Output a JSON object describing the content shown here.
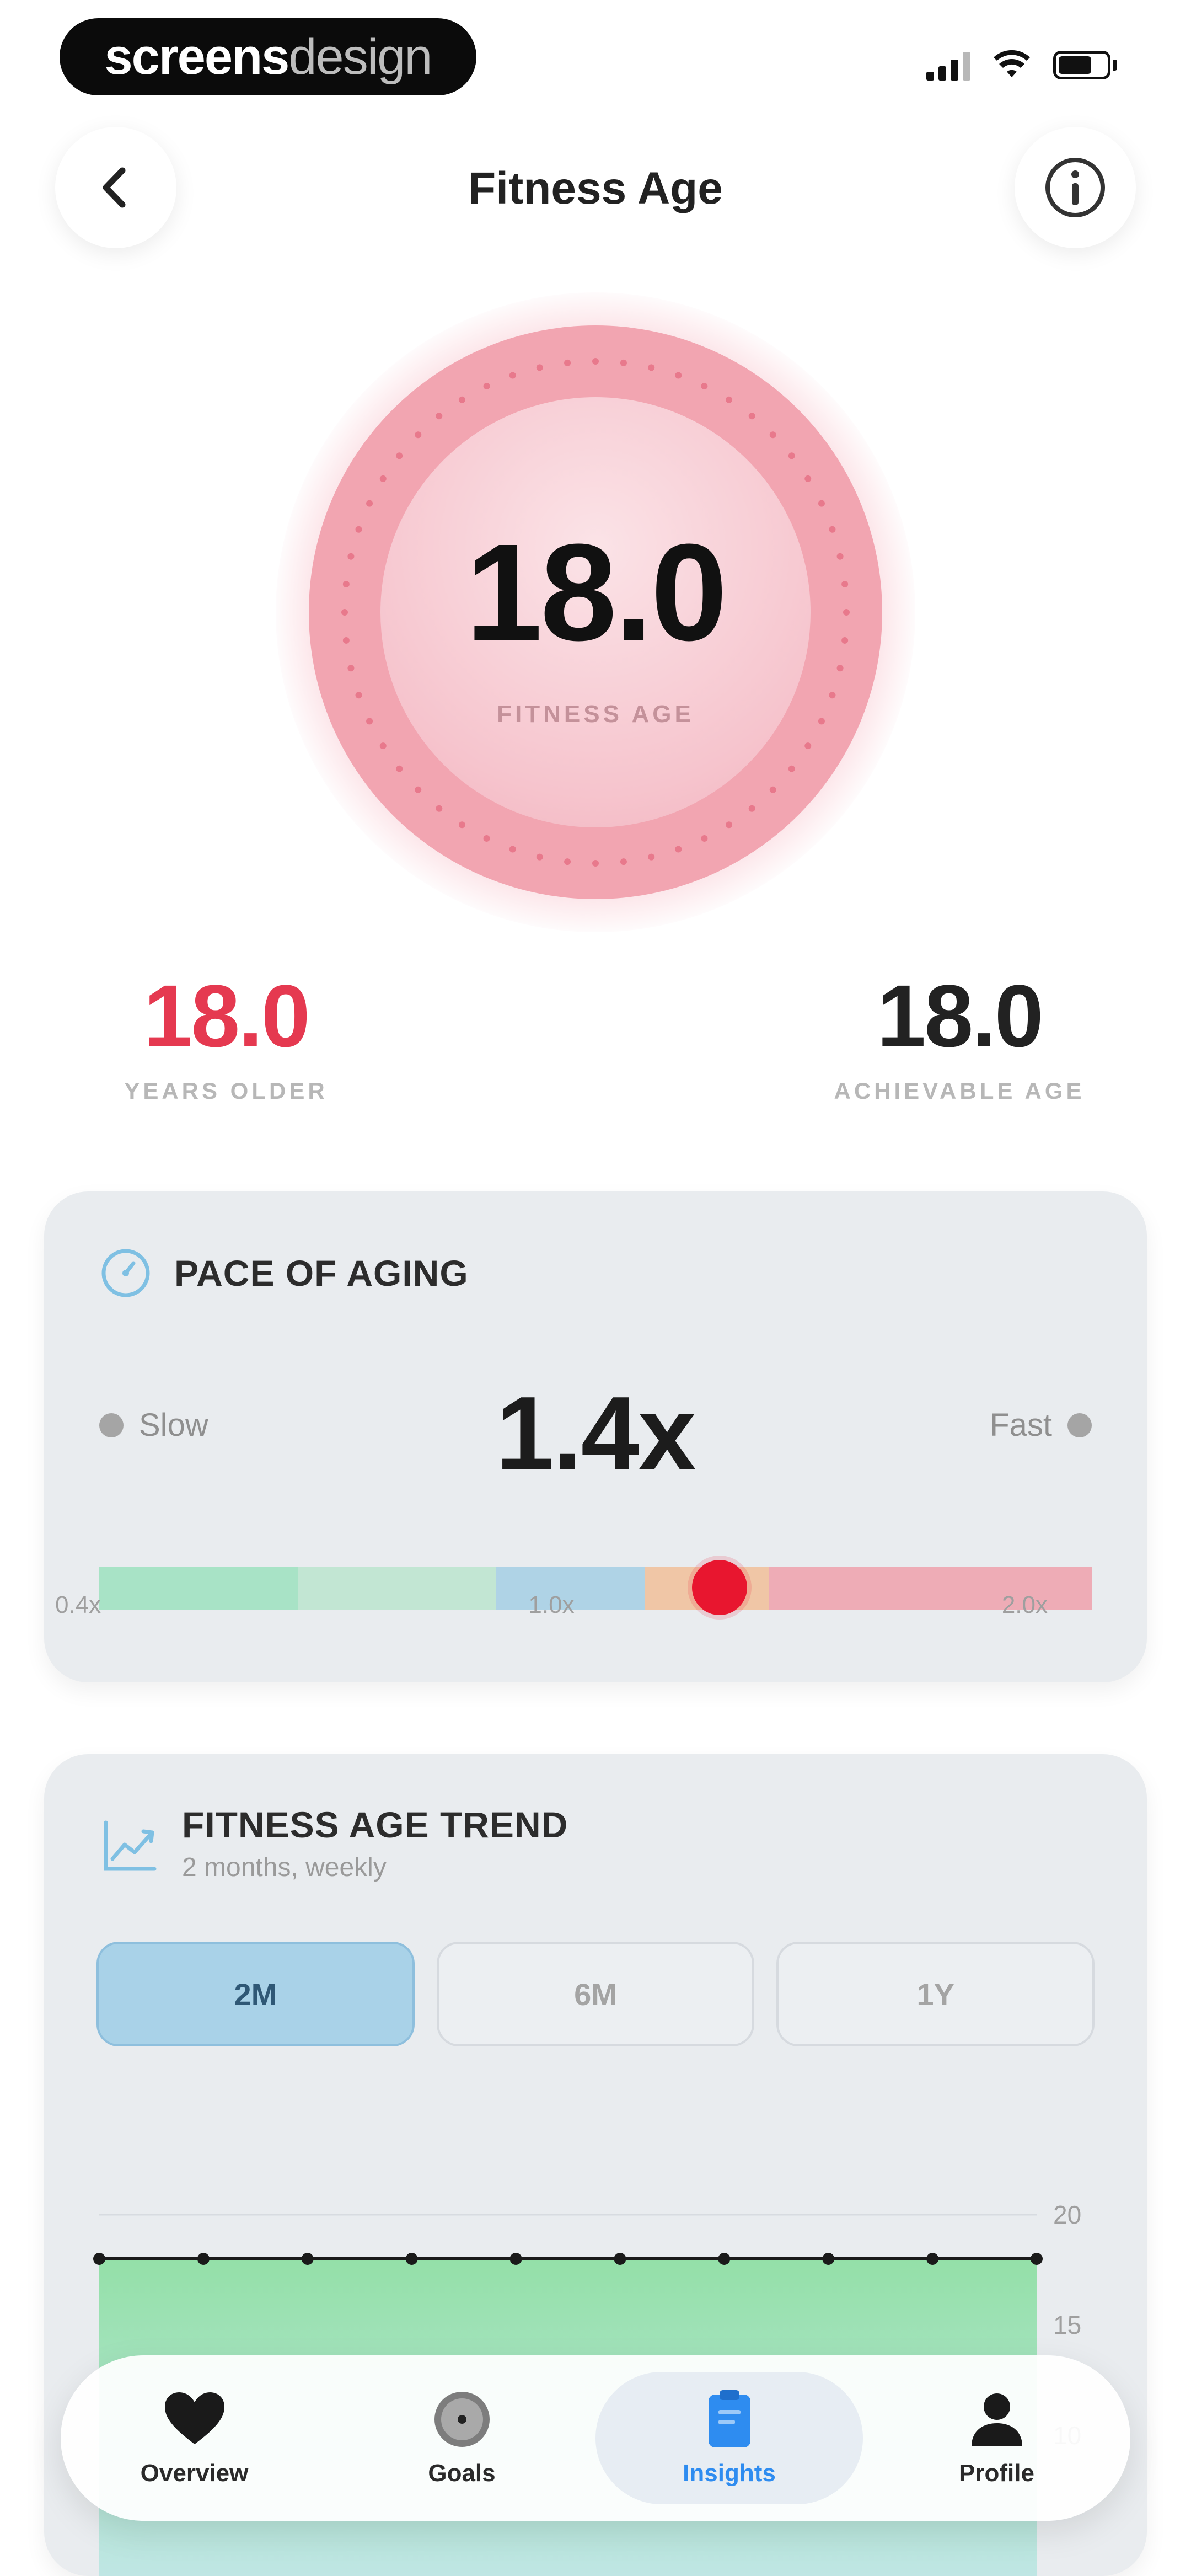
{
  "status_bar": {
    "brand_primary": "screens",
    "brand_secondary": "design"
  },
  "header": {
    "title": "Fitness Age",
    "back_icon": "chevron-left-icon",
    "info_icon": "info-icon"
  },
  "ring": {
    "value": "18.0",
    "label": "FITNESS AGE",
    "accent_color": "#f2a5b1"
  },
  "stats": {
    "left": {
      "value": "18.0",
      "label": "YEARS OLDER",
      "color": "#e53950"
    },
    "right": {
      "value": "18.0",
      "label": "ACHIEVABLE AGE",
      "color": "#222222"
    }
  },
  "pace_card": {
    "title": "PACE OF AGING",
    "icon": "speedometer-icon",
    "slow_label": "Slow",
    "fast_label": "Fast",
    "value": "1.4x",
    "marker_value": 1.4,
    "scale_min": 0.4,
    "scale_max": 2.0,
    "ticks": [
      "0.4x",
      "1.0x",
      "2.0x"
    ],
    "segments": [
      {
        "color": "#a8e3c6",
        "from": 0.4,
        "to": 0.72
      },
      {
        "color": "#c2e6d3",
        "from": 0.72,
        "to": 1.04
      },
      {
        "color": "#afd3e6",
        "from": 1.04,
        "to": 1.28
      },
      {
        "color": "#f0c6a6",
        "from": 1.28,
        "to": 1.48
      },
      {
        "color": "#eeacb6",
        "from": 1.48,
        "to": 2.0
      }
    ]
  },
  "trend_card": {
    "title": "FITNESS AGE TREND",
    "subtitle": "2 months, weekly",
    "icon": "trend-chart-icon",
    "ranges": [
      "2M",
      "6M",
      "1Y"
    ],
    "active_range": "2M"
  },
  "chart_data": {
    "type": "area",
    "x": [
      1,
      2,
      3,
      4,
      5,
      6,
      7,
      8,
      9,
      10
    ],
    "series": [
      {
        "values": [
          18,
          18,
          18,
          18,
          18,
          18,
          18,
          18,
          18,
          18
        ]
      }
    ],
    "yticks": [
      20,
      15,
      10
    ],
    "ylim": [
      0,
      20
    ],
    "grid": true,
    "line_color": "#1a1a1a",
    "fill_color": "#9ee3b0"
  },
  "bottom_nav": {
    "items": [
      {
        "label": "Overview",
        "icon": "heart-icon",
        "active": false
      },
      {
        "label": "Goals",
        "icon": "target-icon",
        "active": false
      },
      {
        "label": "Insights",
        "icon": "clipboard-icon",
        "active": true
      },
      {
        "label": "Profile",
        "icon": "person-icon",
        "active": false
      }
    ]
  }
}
